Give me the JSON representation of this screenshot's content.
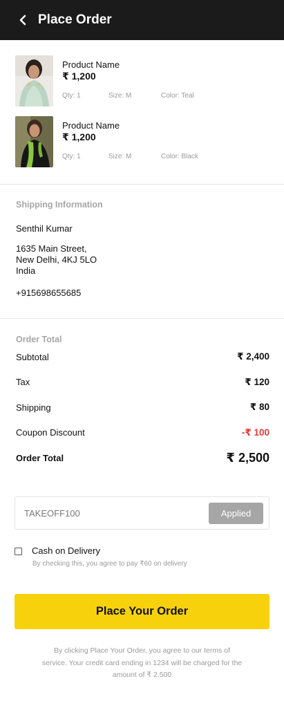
{
  "header": {
    "title": "Place Order",
    "back_icon": "chevron-left-icon"
  },
  "products": [
    {
      "name": "Product Name",
      "price": "₹ 1,200",
      "qty": "Qty: 1",
      "size": "Size: M",
      "color": "Color: Teal"
    },
    {
      "name": "Product Name",
      "price": "₹ 1,200",
      "qty": "Qty: 1",
      "size": "Size: M",
      "color": "Color: Black"
    }
  ],
  "shipping": {
    "title": "Shipping Information",
    "name": "Senthil Kumar",
    "address_lines": [
      "1635 Main Street,",
      "New Delhi, 4KJ 5LO",
      "India"
    ],
    "phone": "+915698655685"
  },
  "order_total": {
    "title": "Order Total",
    "rows": [
      {
        "label": "Subtotal",
        "value": "₹ 2,400"
      },
      {
        "label": "Tax",
        "value": "₹ 120"
      },
      {
        "label": "Shipping",
        "value": "₹ 80"
      },
      {
        "label": "Coupon Discount",
        "value": "-₹ 100"
      },
      {
        "label": "Order Total",
        "value": "₹ 2,500"
      }
    ]
  },
  "coupon": {
    "code": "TAKEOFF100",
    "button_label": "Applied"
  },
  "cod": {
    "label": "Cash on Delivery",
    "note": "By checking this, you agree to pay ₹60 on delivery",
    "checked": false
  },
  "place_order_label": "Place Your Order",
  "legal_text": "By clicking Place Your Order, you agree to our terms of service. Your credit card ending in 1234 will be charged for the amount of ₹ 2,500",
  "colors": {
    "header_bg": "#1b1b1b",
    "accent": "#f7d20c",
    "discount": "#e53935",
    "muted": "#9a9a9a",
    "applied_bg": "#a6a6a6"
  }
}
